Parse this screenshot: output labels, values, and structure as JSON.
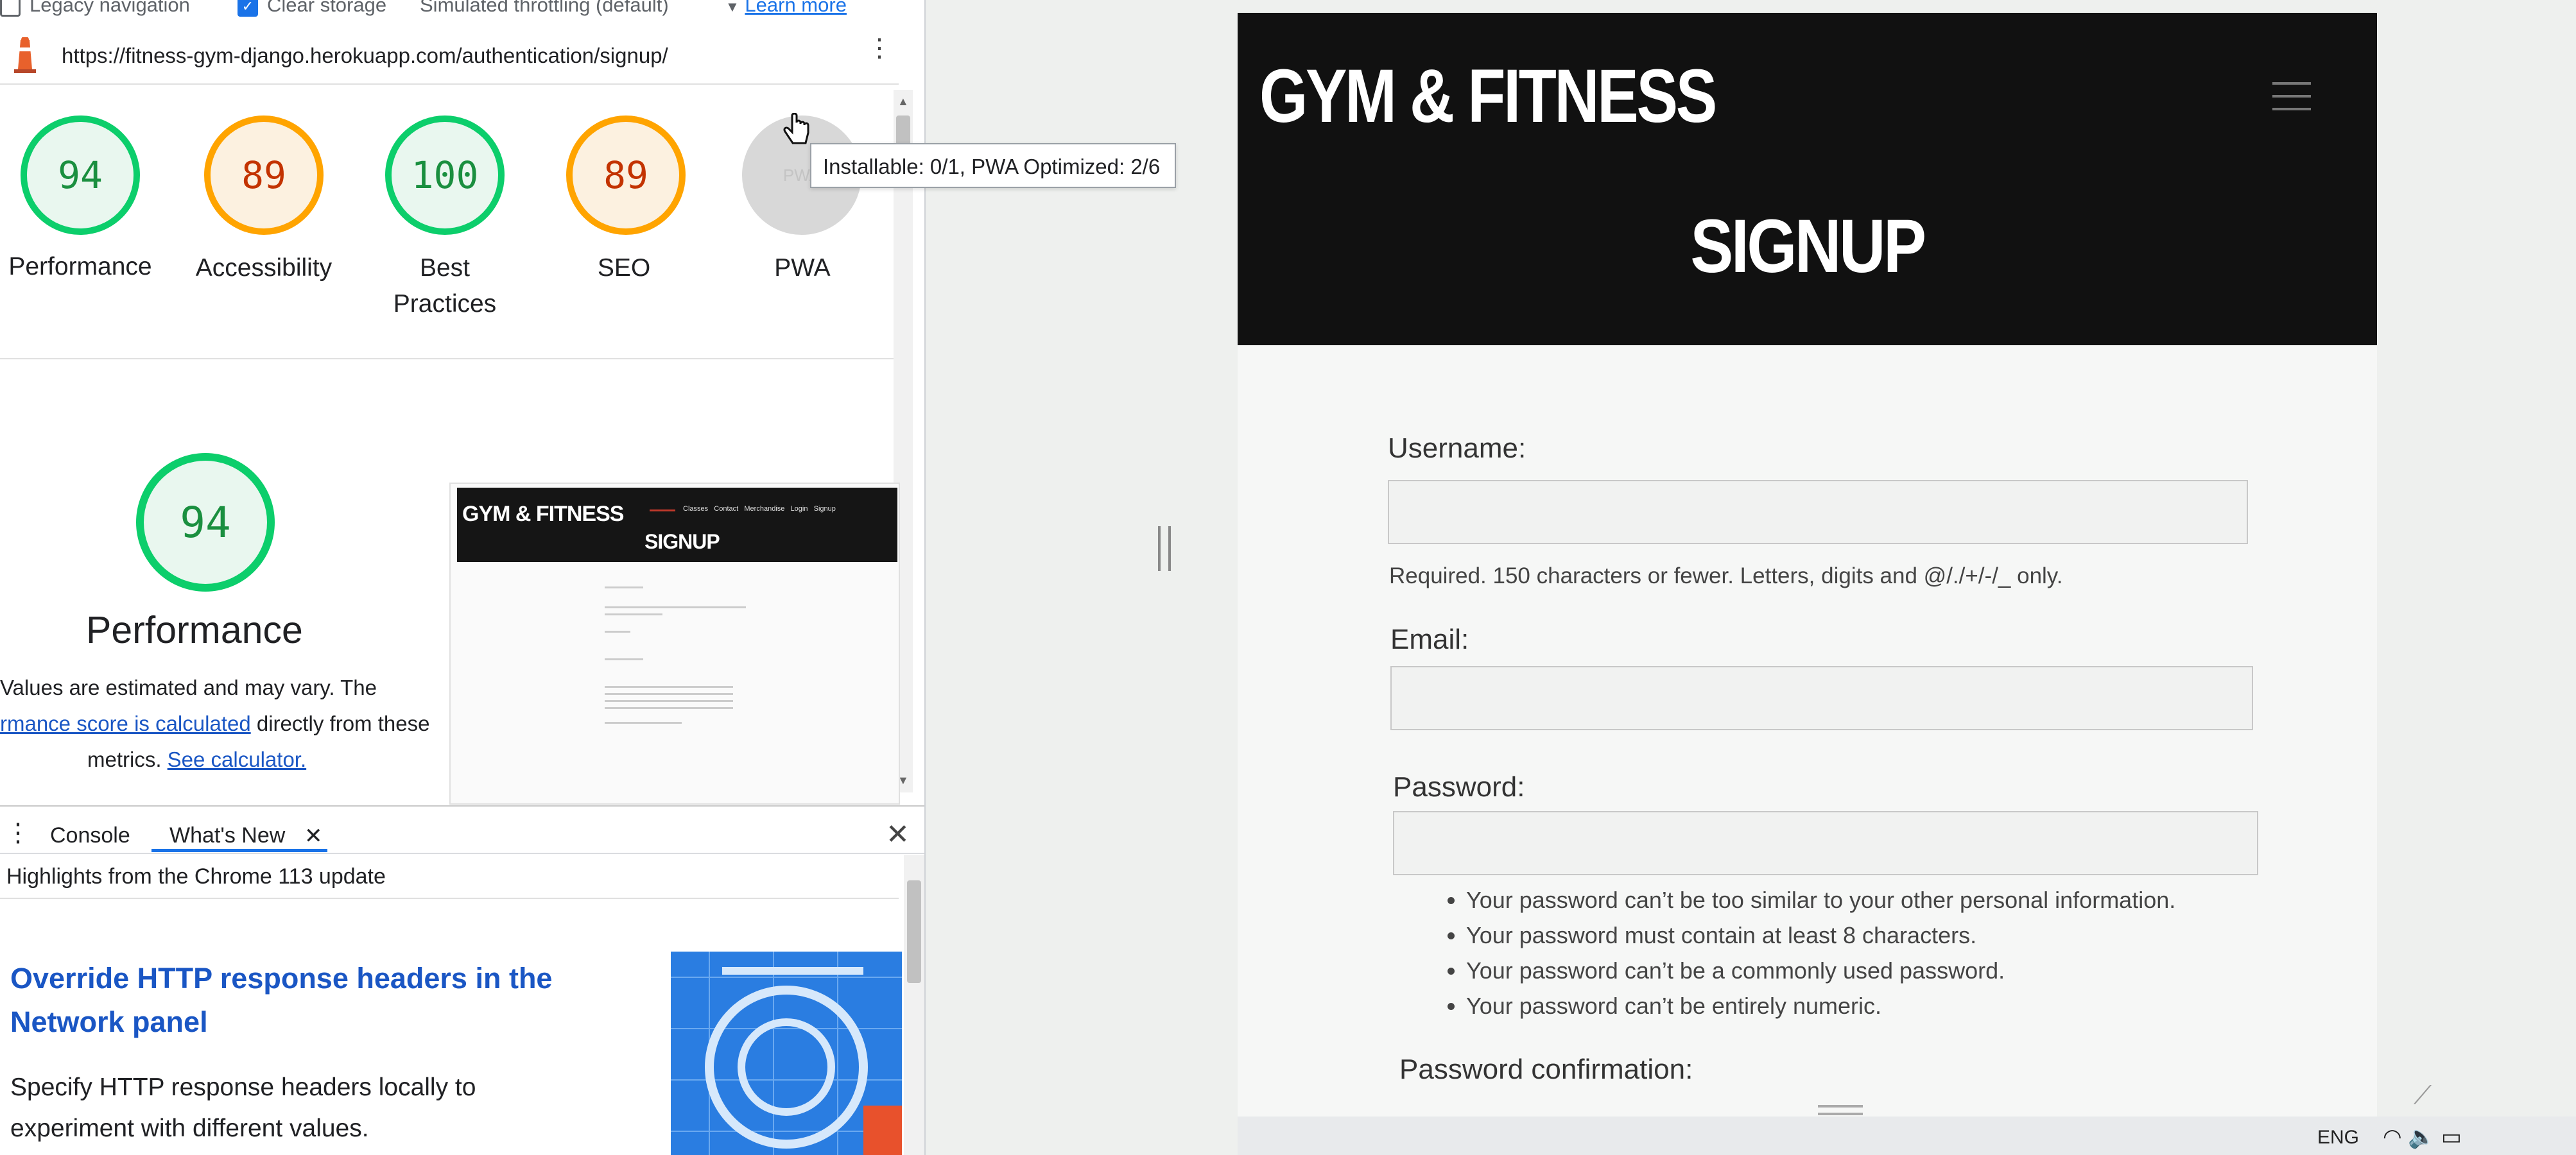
{
  "devtools": {
    "topbar": {
      "legacy_navigation": "Legacy navigation",
      "clear_storage": "Clear storage",
      "throttling": "Simulated throttling (default)",
      "learn_more": "Learn more"
    },
    "url": "https://fitness-gym-django.herokuapp.com/authentication/signup/",
    "scores": [
      {
        "label": "Performance",
        "value": "94",
        "status": "good"
      },
      {
        "label": "Accessibility",
        "value": "89",
        "status": "average"
      },
      {
        "label": "Best Practices",
        "value": "100",
        "status": "good"
      },
      {
        "label": "SEO",
        "value": "89",
        "status": "average"
      },
      {
        "label": "PWA",
        "value": "",
        "status": "na"
      }
    ],
    "best_practices_line1": "Best",
    "best_practices_line2": "Practices",
    "pwa_tooltip": "Installable: 0/1, PWA Optimized: 2/6",
    "performance_section": {
      "score": "94",
      "title": "Performance",
      "desc_line1": "Values are estimated and may vary. The",
      "desc_link": "rmance score is calculated",
      "desc_line2_rest": " directly from these",
      "desc_line3": "metrics.",
      "calculator_link": "See calculator."
    },
    "thumbnail": {
      "logo": "GYM & FITNESS",
      "title": "SIGNUP",
      "nav": [
        "Classes",
        "Contact",
        "Merchandise",
        "Login",
        "Signup"
      ]
    },
    "drawer": {
      "tabs": [
        "Console",
        "What's New"
      ],
      "highlights": "Highlights from the Chrome 113 update",
      "article_title": "Override HTTP response headers in the Network panel",
      "article_body": "Specify HTTP response headers locally to experiment with different values."
    }
  },
  "site": {
    "logo": "GYM & FITNESS",
    "page_title": "SIGNUP",
    "form": {
      "username_label": "Username:",
      "username_help": "Required. 150 characters or fewer. Letters, digits and @/./+/-/_ only.",
      "email_label": "Email:",
      "password_label": "Password:",
      "password_rules": [
        "Your password can’t be too similar to your other personal information.",
        "Your password must contain at least 8 characters.",
        "Your password can’t be a commonly used password.",
        "Your password can’t be entirely numeric."
      ],
      "password_confirm_label": "Password confirmation:"
    }
  },
  "taskbar": {
    "language": "ENG"
  },
  "colors": {
    "good": "#0cce6b",
    "average": "#ffa400",
    "link": "#1a56c4",
    "hero_bg": "#111111"
  }
}
